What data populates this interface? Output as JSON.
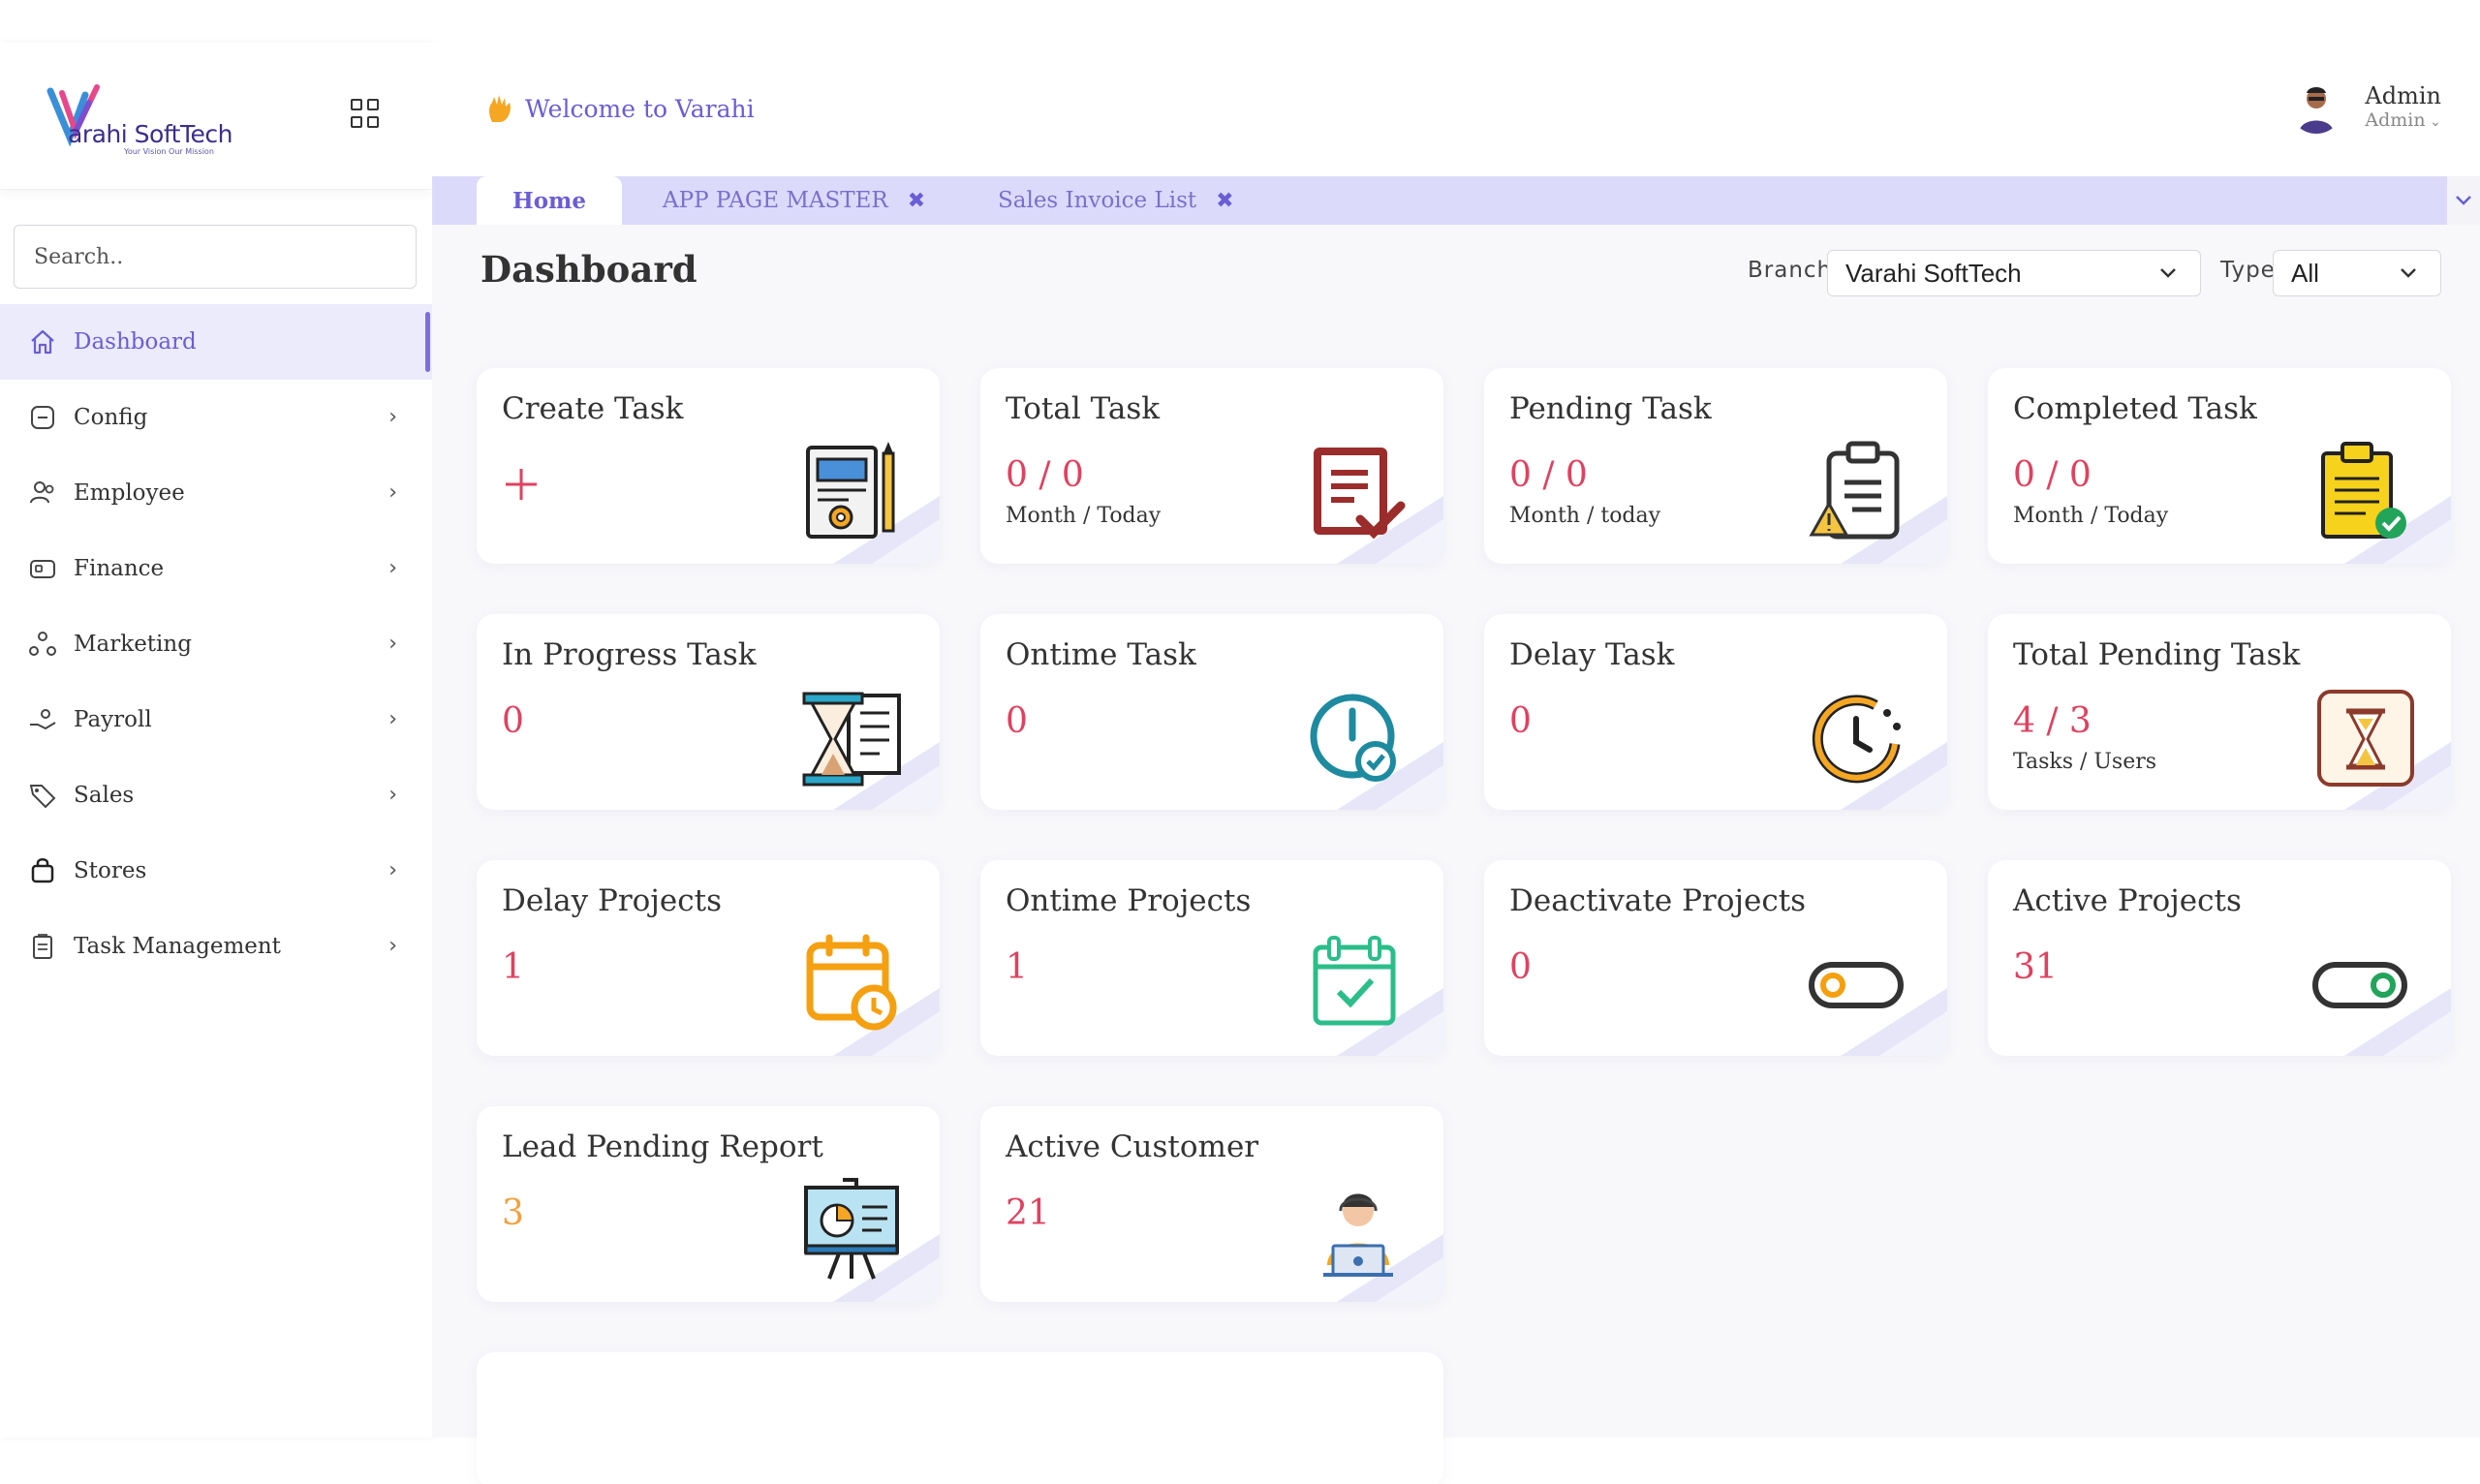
{
  "brand": {
    "logo_text": "arahi SoftTech",
    "tagline": "Your Vision Our Mission"
  },
  "search": {
    "placeholder": "Search.."
  },
  "sidebar": {
    "items": [
      {
        "label": "Dashboard",
        "icon": "home-icon",
        "active": true
      },
      {
        "label": "Config",
        "icon": "config-icon",
        "active": false
      },
      {
        "label": "Employee",
        "icon": "employee-icon",
        "active": false
      },
      {
        "label": "Finance",
        "icon": "finance-icon",
        "active": false
      },
      {
        "label": "Marketing",
        "icon": "marketing-icon",
        "active": false
      },
      {
        "label": "Payroll",
        "icon": "payroll-icon",
        "active": false
      },
      {
        "label": "Sales",
        "icon": "sales-tag-icon",
        "active": false
      },
      {
        "label": "Stores",
        "icon": "shopping-bag-icon",
        "active": false
      },
      {
        "label": "Task Management",
        "icon": "clipboard-icon",
        "active": false
      }
    ]
  },
  "header": {
    "welcome": "Welcome to Varahi",
    "user_name": "Admin",
    "user_role": "Admin"
  },
  "tabs": [
    {
      "label": "Home",
      "active": true,
      "closable": false
    },
    {
      "label": "APP PAGE MASTER",
      "active": false,
      "closable": true
    },
    {
      "label": "Sales Invoice List",
      "active": false,
      "closable": true
    }
  ],
  "page": {
    "title": "Dashboard",
    "branch_label": "Branch",
    "branch_value": "Varahi SoftTech",
    "type_label": "Type",
    "type_value": "All"
  },
  "cards": [
    {
      "title": "Create Task",
      "value": "",
      "sub": "",
      "icon": "task-document-gear-icon"
    },
    {
      "title": "Total Task",
      "value": "0 / 0",
      "sub": "Month / Today",
      "icon": "document-check-icon"
    },
    {
      "title": "Pending Task",
      "value": "0 / 0",
      "sub": "Month / today",
      "icon": "clipboard-warning-icon"
    },
    {
      "title": "Completed Task",
      "value": "0 / 0",
      "sub": "Month / Today",
      "icon": "clipboard-checked-icon"
    },
    {
      "title": "In Progress Task",
      "value": "0",
      "sub": "",
      "icon": "hourglass-sheet-icon"
    },
    {
      "title": "Ontime Task",
      "value": "0",
      "sub": "",
      "icon": "clock-check-icon"
    },
    {
      "title": "Delay Task",
      "value": "0",
      "sub": "",
      "icon": "clock-delay-icon"
    },
    {
      "title": "Total Pending Task",
      "value": "4 / 3",
      "sub": "Tasks / Users",
      "icon": "hourglass-frame-icon"
    },
    {
      "title": "Delay Projects",
      "value": "1",
      "sub": "",
      "icon": "calendar-clock-icon"
    },
    {
      "title": "Ontime Projects",
      "value": "1",
      "sub": "",
      "icon": "calendar-check-icon"
    },
    {
      "title": "Deactivate Projects",
      "value": "0",
      "sub": "",
      "icon": "toggle-off-icon"
    },
    {
      "title": "Active Projects",
      "value": "31",
      "sub": "",
      "icon": "toggle-on-icon"
    },
    {
      "title": "Lead Pending Report",
      "value": "3",
      "sub": "",
      "icon": "presentation-chart-icon"
    },
    {
      "title": "Active Customer",
      "value": "21",
      "sub": "",
      "icon": "customer-support-icon"
    }
  ],
  "colors": {
    "accent": "#6a5dd6",
    "value_red": "#e0415f",
    "value_orange": "#f2a03c",
    "tab_bar": "#dcdafa"
  }
}
